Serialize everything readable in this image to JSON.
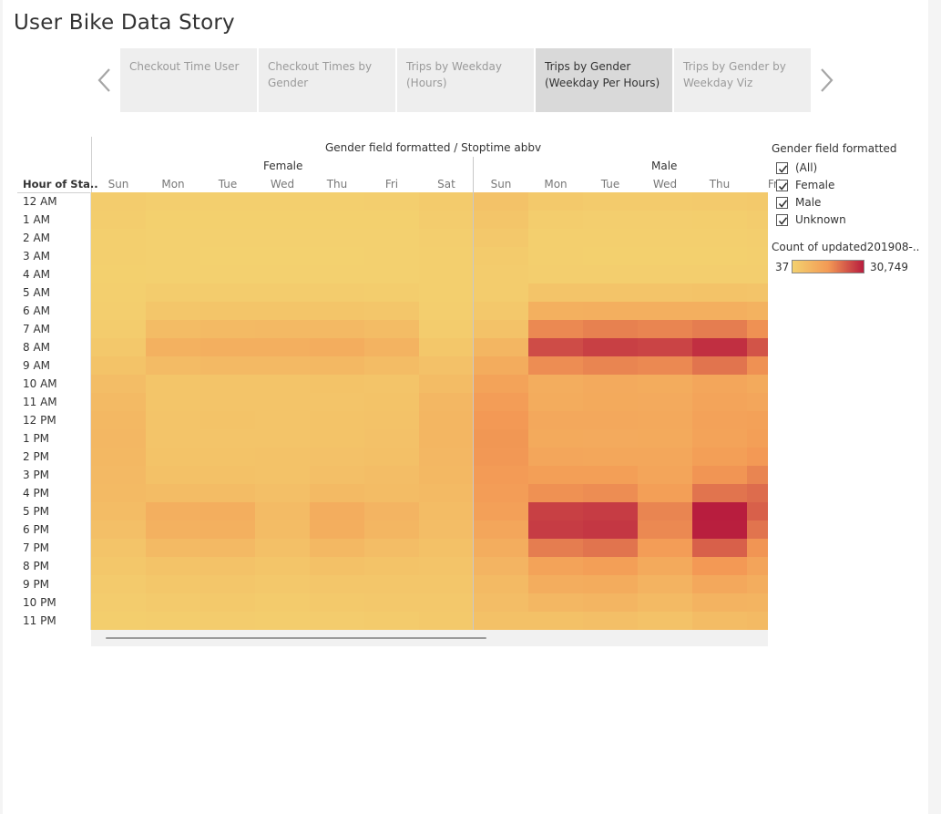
{
  "title": "User Bike Data Story",
  "tabs": [
    {
      "label": "Checkout Time User",
      "active": false
    },
    {
      "label": "Checkout Times by Gender",
      "active": false
    },
    {
      "label": "Trips by Weekday (Hours)",
      "active": false
    },
    {
      "label": "Trips by Gender (Weekday Per Hours)",
      "active": true
    },
    {
      "label": "Trips by Gender by Weekday Viz",
      "active": false
    }
  ],
  "nav": {
    "prev_icon": "chevron-left-icon",
    "next_icon": "chevron-right-icon"
  },
  "chart_data": {
    "type": "heatmap",
    "title": "Gender field formatted / Stoptime abbv",
    "row_header": "Hour of Sta..",
    "groups": [
      "Female",
      "Male"
    ],
    "days": [
      [
        "Sun",
        "Mon",
        "Tue",
        "Wed",
        "Thu",
        "Fri",
        "Sat"
      ],
      [
        "Sun",
        "Mon",
        "Tue",
        "Wed",
        "Thu",
        "Fri"
      ]
    ],
    "hours": [
      "12 AM",
      "1 AM",
      "2 AM",
      "3 AM",
      "4 AM",
      "5 AM",
      "6 AM",
      "7 AM",
      "8 AM",
      "9 AM",
      "10 AM",
      "11 AM",
      "12 PM",
      "1 PM",
      "2 PM",
      "3 PM",
      "4 PM",
      "5 PM",
      "6 PM",
      "7 PM",
      "8 PM",
      "9 PM",
      "10 PM",
      "11 PM"
    ],
    "series": [
      {
        "name": "Female",
        "columns": [
          "Sun",
          "Mon",
          "Tue",
          "Wed",
          "Thu",
          "Fri",
          "Sat"
        ],
        "values": [
          [
            1500,
            800,
            700,
            700,
            700,
            800,
            1700
          ],
          [
            1100,
            400,
            350,
            350,
            350,
            400,
            1300
          ],
          [
            700,
            250,
            200,
            200,
            200,
            250,
            900
          ],
          [
            500,
            200,
            150,
            150,
            150,
            200,
            600
          ],
          [
            400,
            300,
            300,
            300,
            300,
            300,
            500
          ],
          [
            500,
            1300,
            1300,
            1300,
            1300,
            1200,
            500
          ],
          [
            800,
            3200,
            3400,
            3400,
            3500,
            3100,
            800
          ],
          [
            1300,
            6000,
            6500,
            6600,
            6800,
            5900,
            1400
          ],
          [
            2500,
            9000,
            9500,
            9500,
            10000,
            8500,
            2700
          ],
          [
            4000,
            6200,
            6800,
            6700,
            7000,
            6000,
            4400
          ],
          [
            5500,
            3500,
            3800,
            3700,
            3900,
            3800,
            6000
          ],
          [
            6500,
            3500,
            3700,
            3600,
            3800,
            3900,
            7200
          ],
          [
            7000,
            3800,
            3900,
            3800,
            4000,
            4300,
            7500
          ],
          [
            7200,
            3700,
            3600,
            3700,
            4000,
            4400,
            7600
          ],
          [
            7000,
            4000,
            3900,
            4100,
            4400,
            4800,
            7200
          ],
          [
            6800,
            4600,
            4600,
            4300,
            5000,
            5600,
            6900
          ],
          [
            6500,
            5800,
            6000,
            5000,
            6500,
            6000,
            6500
          ],
          [
            6000,
            9500,
            9800,
            6200,
            10000,
            8000,
            6000
          ],
          [
            5000,
            9000,
            9300,
            6000,
            9800,
            7500,
            5500
          ],
          [
            3800,
            6500,
            6800,
            4800,
            7000,
            5500,
            4500
          ],
          [
            2800,
            4000,
            4300,
            3300,
            4600,
            4000,
            3600
          ],
          [
            2000,
            2800,
            3000,
            2500,
            3200,
            3200,
            3000
          ],
          [
            1500,
            2000,
            2200,
            1800,
            2400,
            2600,
            2600
          ],
          [
            1000,
            1200,
            1300,
            1100,
            1500,
            1800,
            2200
          ]
        ]
      },
      {
        "name": "Male",
        "columns": [
          "Sun",
          "Mon",
          "Tue",
          "Wed",
          "Thu",
          "Fri"
        ],
        "values": [
          [
            4300,
            2200,
            1800,
            1800,
            1900,
            2400
          ],
          [
            3300,
            1100,
            900,
            900,
            1000,
            1300
          ],
          [
            2500,
            700,
            600,
            600,
            600,
            800
          ],
          [
            1800,
            500,
            450,
            450,
            450,
            550
          ],
          [
            1300,
            800,
            800,
            800,
            800,
            800
          ],
          [
            1500,
            3800,
            3800,
            3800,
            3900,
            3700
          ],
          [
            2500,
            9200,
            9500,
            9400,
            9600,
            8800
          ],
          [
            4200,
            17500,
            18500,
            18000,
            19000,
            16500
          ],
          [
            7500,
            25000,
            26500,
            26000,
            28500,
            24000
          ],
          [
            10500,
            17000,
            18000,
            17500,
            20000,
            16500
          ],
          [
            13000,
            10000,
            10800,
            10500,
            12000,
            11000
          ],
          [
            14500,
            10500,
            11000,
            10800,
            12500,
            12000
          ],
          [
            15500,
            11500,
            11500,
            11300,
            13200,
            13500
          ],
          [
            15800,
            11000,
            10800,
            11000,
            13000,
            14000
          ],
          [
            15600,
            12000,
            11800,
            11800,
            14000,
            15500
          ],
          [
            15000,
            14000,
            14000,
            12300,
            16000,
            18000
          ],
          [
            14500,
            16500,
            17000,
            14000,
            20000,
            21000
          ],
          [
            13800,
            26500,
            27000,
            18000,
            30749,
            22500
          ],
          [
            12000,
            27000,
            27500,
            17500,
            30500,
            20000
          ],
          [
            10000,
            19000,
            20000,
            14500,
            22500,
            16000
          ],
          [
            8000,
            13000,
            14000,
            11000,
            15500,
            12500
          ],
          [
            6500,
            10000,
            10500,
            8500,
            11500,
            10000
          ],
          [
            5500,
            7200,
            7800,
            6500,
            8500,
            8200
          ],
          [
            4500,
            4500,
            5000,
            4200,
            5800,
            6500
          ]
        ]
      }
    ],
    "color_scale": {
      "title": "Count of updated201908-..",
      "min": 37,
      "max": 30749,
      "min_label": "37",
      "max_label": "30,749",
      "colors": [
        "#f3d16f",
        "#f39a55",
        "#b81d3e"
      ]
    }
  },
  "legend": {
    "title": "Gender field formatted",
    "items": [
      {
        "label": "(All)",
        "checked": true
      },
      {
        "label": "Female",
        "checked": true
      },
      {
        "label": "Male",
        "checked": true
      },
      {
        "label": "Unknown",
        "checked": true
      }
    ]
  }
}
